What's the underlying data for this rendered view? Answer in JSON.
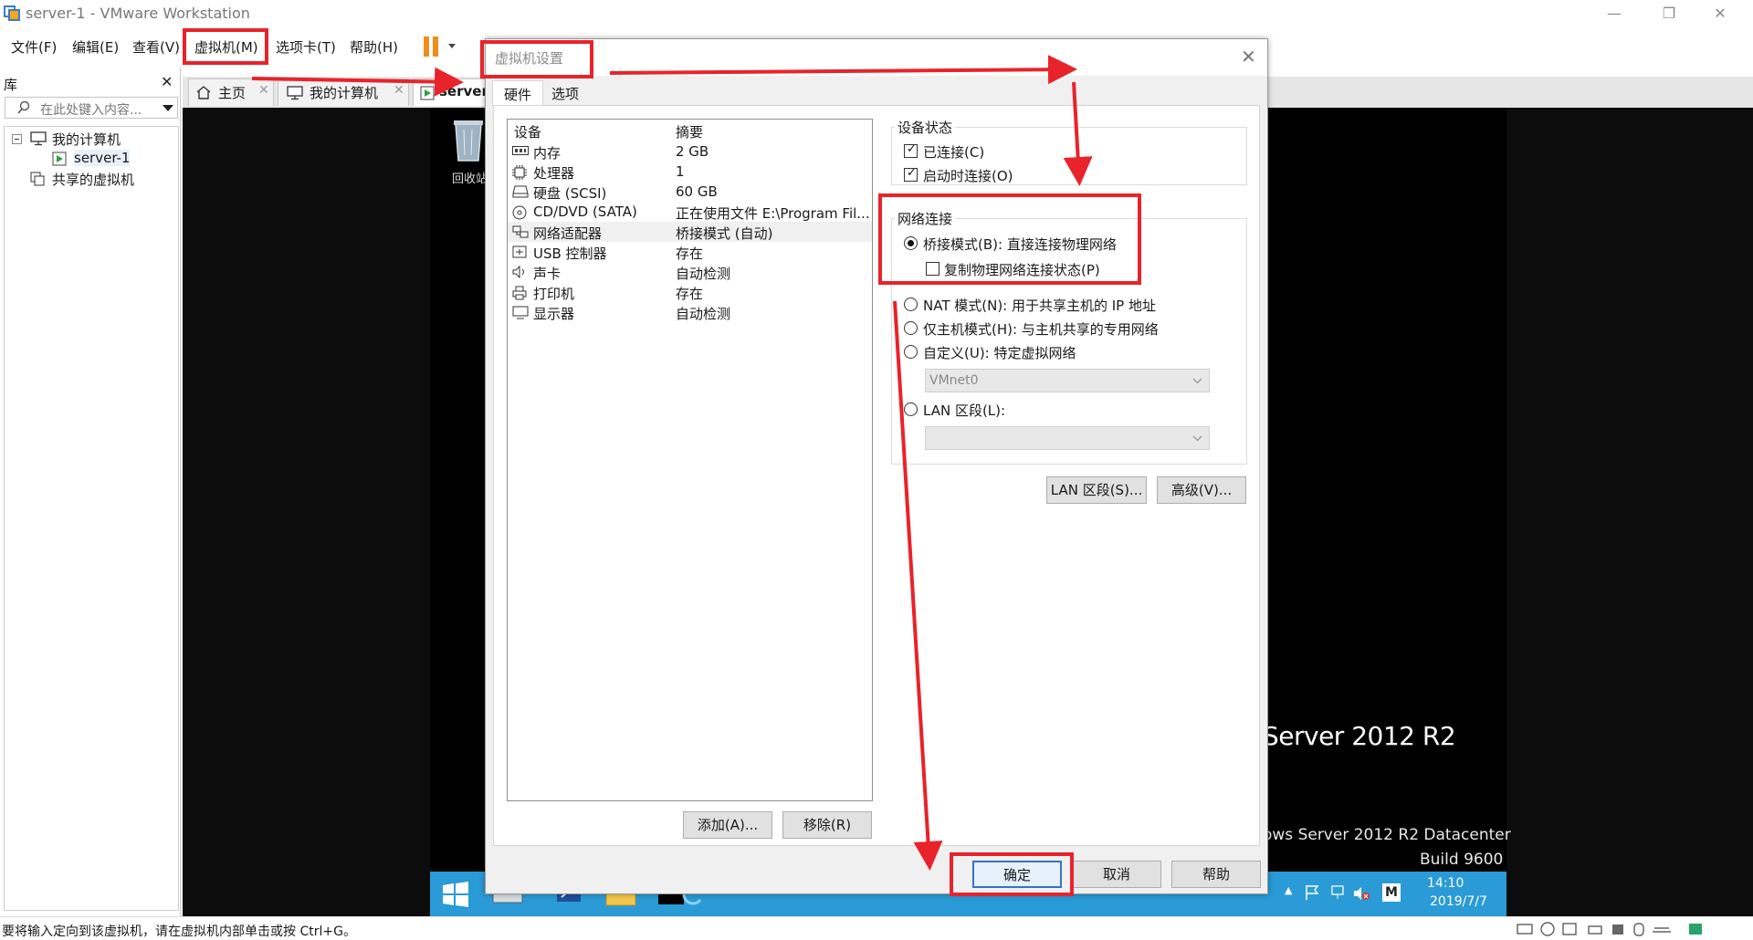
{
  "window": {
    "title": "server-1 - VMware Workstation"
  },
  "menu": [
    "文件(F)",
    "编辑(E)",
    "查看(V)",
    "虚拟机(M)",
    "选项卡(T)",
    "帮助(H)"
  ],
  "library": {
    "header": "库",
    "search_placeholder": "在此处键入内容...",
    "tree": {
      "my_computer": "我的计算机",
      "vm": "server-1",
      "shared": "共享的虚拟机"
    }
  },
  "tabs": {
    "home": "主页",
    "my_computer": "我的计算机",
    "server": "server"
  },
  "vm_screen": {
    "recycle_bin": "回收站",
    "os_title": "Server 2012 R2",
    "edition": "ows Server 2012 R2 Datacenter",
    "build": "Build 9600",
    "clock_time": "14:10",
    "clock_date": "2019/7/7",
    "tray_letter": "M"
  },
  "status_bar": "要将输入定向到该虚拟机，请在虚拟机内部单击或按 Ctrl+G。",
  "dialog": {
    "title": "虚拟机设置",
    "tabs": [
      "硬件",
      "选项"
    ],
    "list_headers": {
      "device": "设备",
      "summary": "摘要"
    },
    "devices": [
      {
        "name": "内存",
        "summary": "2 GB",
        "icon": "memory-icon"
      },
      {
        "name": "处理器",
        "summary": "1",
        "icon": "cpu-icon"
      },
      {
        "name": "硬盘 (SCSI)",
        "summary": "60 GB",
        "icon": "harddisk-icon"
      },
      {
        "name": "CD/DVD (SATA)",
        "summary": "正在使用文件 E:\\Program Fil...",
        "icon": "cd-icon"
      },
      {
        "name": "网络适配器",
        "summary": "桥接模式 (自动)",
        "icon": "network-icon"
      },
      {
        "name": "USB 控制器",
        "summary": "存在",
        "icon": "usb-icon"
      },
      {
        "name": "声卡",
        "summary": "自动检测",
        "icon": "sound-icon"
      },
      {
        "name": "打印机",
        "summary": "存在",
        "icon": "printer-icon"
      },
      {
        "name": "显示器",
        "summary": "自动检测",
        "icon": "monitor-icon"
      }
    ],
    "add_button": "添加(A)...",
    "remove_button": "移除(R)",
    "device_status": {
      "title": "设备状态",
      "connected": "已连接(C)",
      "connect_at_power_on": "启动时连接(O)"
    },
    "network": {
      "title": "网络连接",
      "bridged": "桥接模式(B): 直接连接物理网络",
      "replicate": "复制物理网络连接状态(P)",
      "nat": "NAT 模式(N): 用于共享主机的 IP 地址",
      "host_only": "仅主机模式(H): 与主机共享的专用网络",
      "custom": "自定义(U): 特定虚拟网络",
      "custom_value": "VMnet0",
      "lan": "LAN 区段(L):"
    },
    "lan_segments_button": "LAN 区段(S)...",
    "advanced_button": "高级(V)...",
    "ok_button": "确定",
    "cancel_button": "取消",
    "help_button": "帮助"
  },
  "colors": {
    "accent_red": "#e8232a",
    "taskbar": "#2a9bd6",
    "pause": "#f08c1c"
  }
}
